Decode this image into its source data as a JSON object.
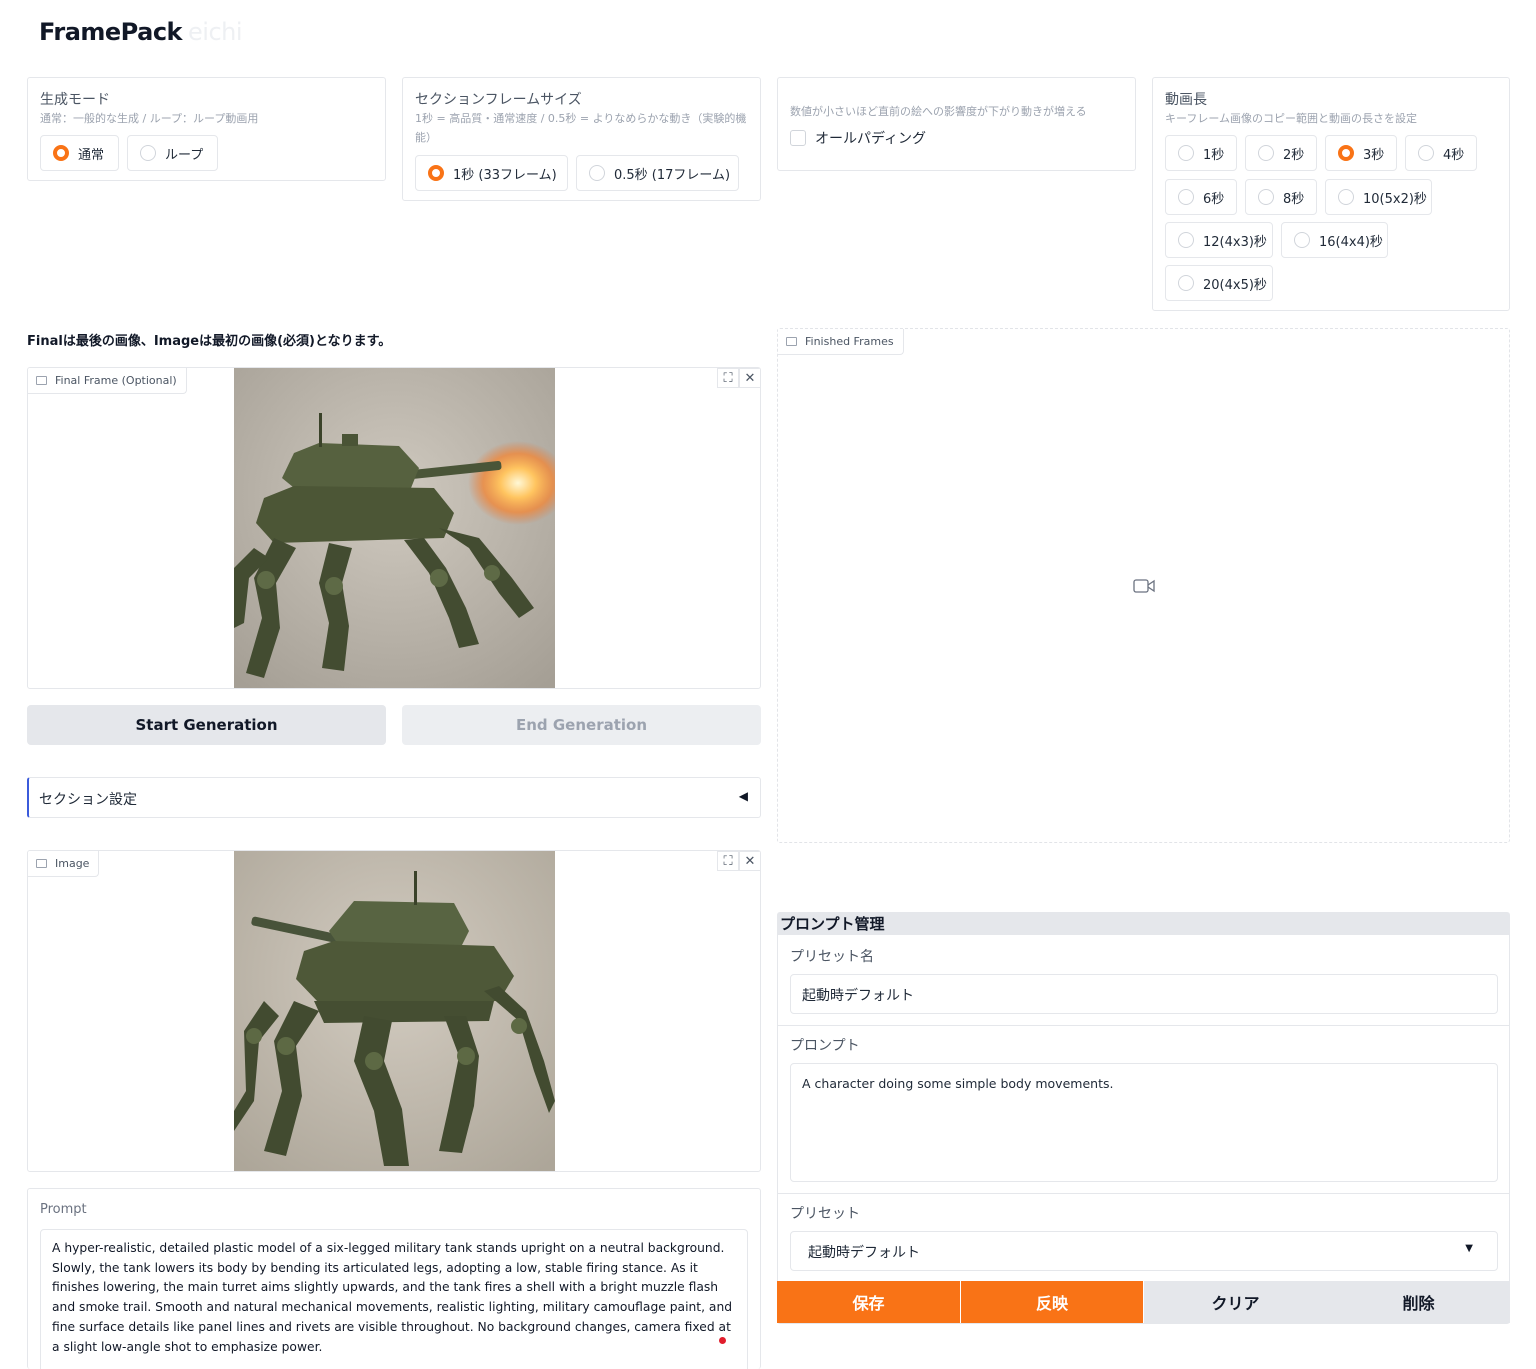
{
  "app": {
    "title": "FramePack",
    "title_faint": "eichi"
  },
  "mode": {
    "label": "生成モード",
    "info": "通常：一般的な生成 / ループ：ループ動画用",
    "options": [
      {
        "label": "通常",
        "selected": true
      },
      {
        "label": "ループ",
        "selected": false
      }
    ]
  },
  "section_frame": {
    "label": "セクションフレームサイズ",
    "info": "1秒 = 高品質・通常速度 / 0.5秒 = よりなめらかな動き（実験的機能）",
    "options": [
      {
        "label": "1秒 (33フレーム)",
        "selected": true
      },
      {
        "label": "0.5秒 (17フレーム)",
        "selected": false
      }
    ]
  },
  "padding": {
    "info": "数値が小さいほど直前の絵への影響度が下がり動きが増える",
    "label": "オールパディング",
    "checked": false
  },
  "length": {
    "label": "動画長",
    "info": "キーフレーム画像のコピー範囲と動画の長さを設定",
    "options": [
      {
        "label": "1秒",
        "selected": false
      },
      {
        "label": "2秒",
        "selected": false
      },
      {
        "label": "3秒",
        "selected": true
      },
      {
        "label": "4秒",
        "selected": false
      },
      {
        "label": "6秒",
        "selected": false
      },
      {
        "label": "8秒",
        "selected": false
      },
      {
        "label": "10(5x2)秒",
        "selected": false
      },
      {
        "label": "12(4x3)秒",
        "selected": false
      },
      {
        "label": "16(4x4)秒",
        "selected": false
      },
      {
        "label": "20(4x5)秒",
        "selected": false
      }
    ]
  },
  "note": "Finalは最後の画像、Imageは最初の画像(必須)となります。",
  "final_frame": {
    "label": "Final Frame (Optional)"
  },
  "image": {
    "label": "Image"
  },
  "finished": {
    "label": "Finished Frames"
  },
  "buttons": {
    "start": "Start Generation",
    "end": "End Generation"
  },
  "section_settings": {
    "label": "セクション設定",
    "arrow": "◀"
  },
  "prompt": {
    "label": "Prompt",
    "value": "A hyper-realistic, detailed plastic model of a six-legged military tank stands upright on a neutral background. Slowly, the tank lowers its body by bending its articulated legs, adopting a low, stable firing stance. As it finishes lowering, the main turret aims slightly upwards, and the tank fires a shell with a bright muzzle flash and smoke trail. Smooth and natural mechanical movements, realistic lighting, military camouflage paint, and fine surface details like panel lines and rivets are visible throughout. No background changes, camera fixed at a slight low-angle shot to emphasize power."
  },
  "prompt_mgmt": {
    "title": "プロンプト管理",
    "preset_name_label": "プリセット名",
    "preset_name_value": "起動時デフォルト",
    "prompt_label": "プロンプト",
    "prompt_value": "A character doing some simple body movements.",
    "preset_label": "プリセット",
    "preset_value": "起動時デフォルト",
    "save": "保存",
    "apply": "反映",
    "clear": "クリア",
    "delete": "削除"
  },
  "colors": {
    "accent": "#f97316",
    "button_gray": "#e5e7eb"
  }
}
